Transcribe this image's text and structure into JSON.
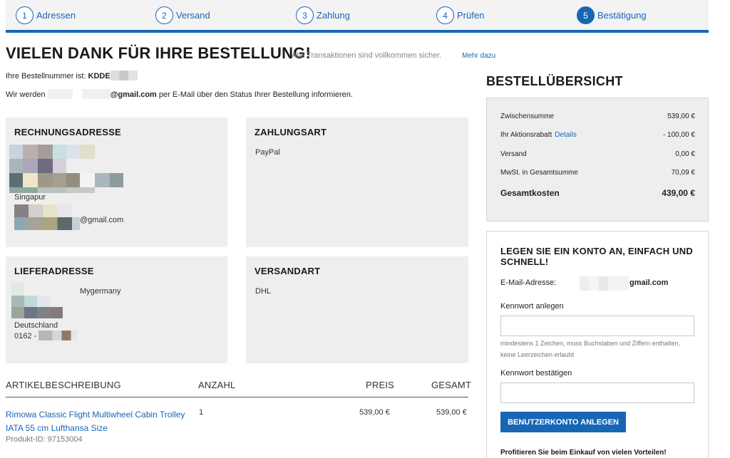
{
  "steps": [
    {
      "num": "1",
      "label": "Adressen"
    },
    {
      "num": "2",
      "label": "Versand"
    },
    {
      "num": "3",
      "label": "Zahlung"
    },
    {
      "num": "4",
      "label": "Prüfen"
    },
    {
      "num": "5",
      "label": "Bestätigung"
    }
  ],
  "header": {
    "title": "VIELEN DANK FÜR IHRE BESTELLUNG!",
    "secure": "Alle Transaktionen sind vollkommen sicher.",
    "more": "Mehr dazu"
  },
  "order": {
    "number_label": "Ihre Bestellnummer ist:",
    "number_prefix": "KDDE",
    "notify_prefix": "Wir werden",
    "notify_email": "@gmail.com",
    "notify_suffix": "per E-Mail über den Status Ihrer Bestellung informieren."
  },
  "billing": {
    "heading": "RECHNUNGSADRESSE",
    "country": "Singapur",
    "email": "@gmail.com"
  },
  "payment": {
    "heading": "ZAHLUNGSART",
    "method": "PayPal"
  },
  "shipping_address": {
    "heading": "LIEFERADRESSE",
    "name": "Mygermany",
    "country": "Deutschland",
    "phone": "0162 -"
  },
  "shipping_method": {
    "heading": "VERSANDART",
    "method": "DHL"
  },
  "table": {
    "headers": [
      "ARTIKELBESCHREIBUNG",
      "ANZAHL",
      "PREIS",
      "GESAMT"
    ],
    "rows": [
      {
        "product": "Rimowa Classic Flight Multiwheel Cabin Trolley IATA 55 cm Lufthansa Size",
        "product_id": "Produkt-ID: 97153004",
        "qty": "1",
        "price": "539,00 €",
        "total": "539,00 €"
      }
    ]
  },
  "summary": {
    "title": "BESTELLÜBERSICHT",
    "rows": [
      {
        "label": "Zwischensumme",
        "value": "539,00 €"
      },
      {
        "label": "Ihr Aktionsrabatt",
        "link": "Details",
        "value": "- 100,00 €"
      },
      {
        "label": "Versand",
        "value": "0,00 €"
      },
      {
        "label": "MwSt. in Gesamtsumme",
        "value": "70,09 €"
      },
      {
        "label": "Gesamtkosten",
        "value": "439,00 €"
      }
    ]
  },
  "account": {
    "heading": "LEGEN SIE EIN KONTO AN, EINFACH UND SCHNELL!",
    "email_label": "E-Mail-Adresse:",
    "email_value": "gmail.com",
    "password_label": "Kennwort anlegen",
    "password_hint": "mindestens 1 Zeichen, muss Buchstaben und Ziffern enthalten, keine Leerzeichen erlaubt",
    "confirm_label": "Kennwort bestätigen",
    "button": "BENUTZERKONTO ANLEGEN",
    "footer": "Profitieren Sie beim Einkauf von vielen Vorteilen!"
  },
  "colors": {
    "accent": "#1766b6",
    "panel": "#eeeeee"
  }
}
